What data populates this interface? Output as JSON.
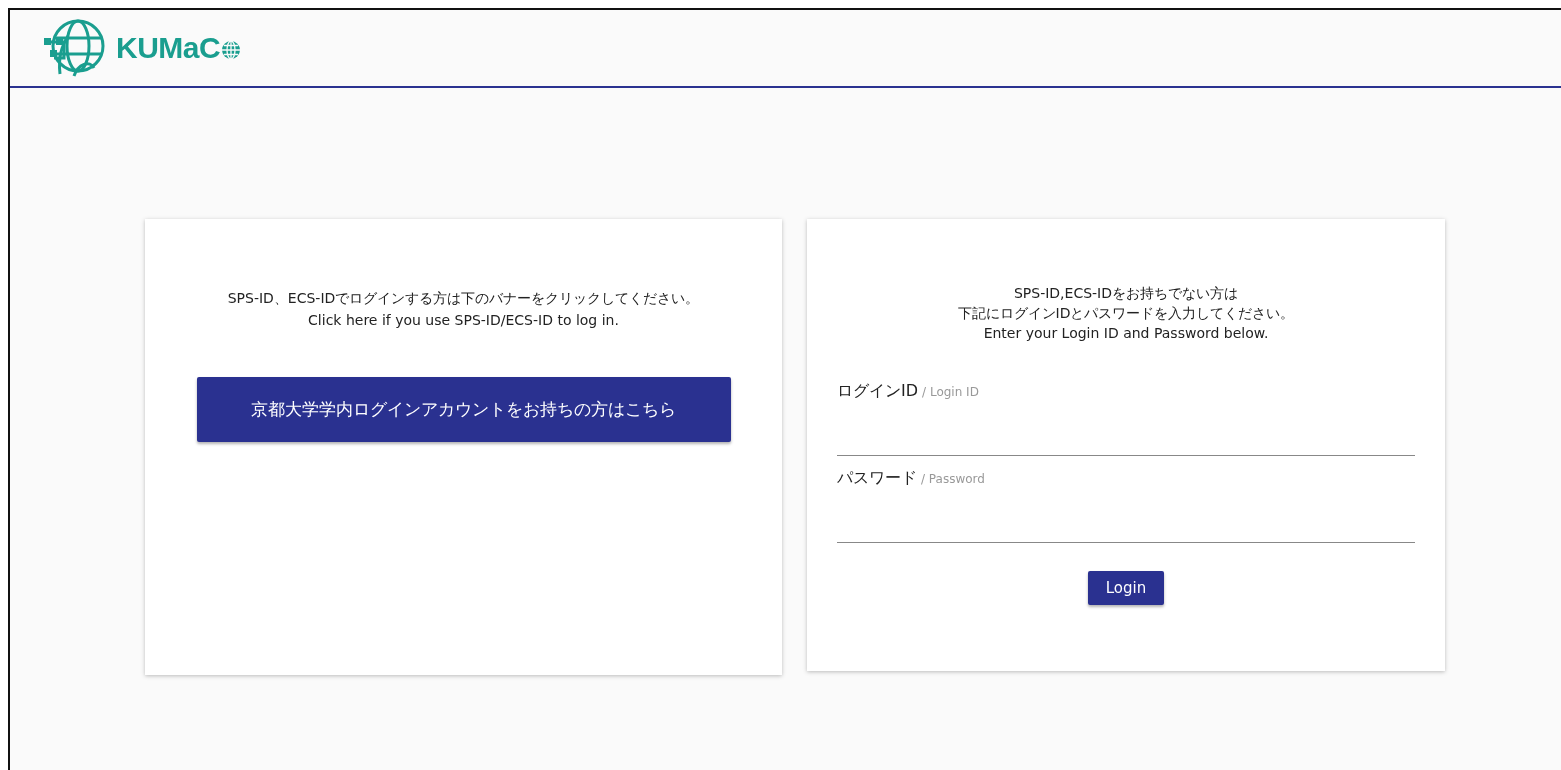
{
  "header": {
    "logo_text": "KUMaC"
  },
  "sso_card": {
    "message_lines": [
      "SPS-ID、ECS-IDでログインする方は下のバナーをクリックしてください。",
      "Click here if you use SPS-ID/ECS-ID to log in."
    ],
    "button": "京都大学学内ログインアカウントをお持ちの方はこちら"
  },
  "login_card": {
    "message_lines": [
      "SPS-ID,ECS-IDをお持ちでない方は",
      "下記にログインIDとパスワードを入力してください。",
      "Enter your Login ID and Password below."
    ],
    "fields": [
      {
        "label": "ログインID",
        "label_en": "/ Login ID"
      },
      {
        "label": "パスワード",
        "label_en": "/ Password"
      }
    ],
    "button": "Login"
  }
}
